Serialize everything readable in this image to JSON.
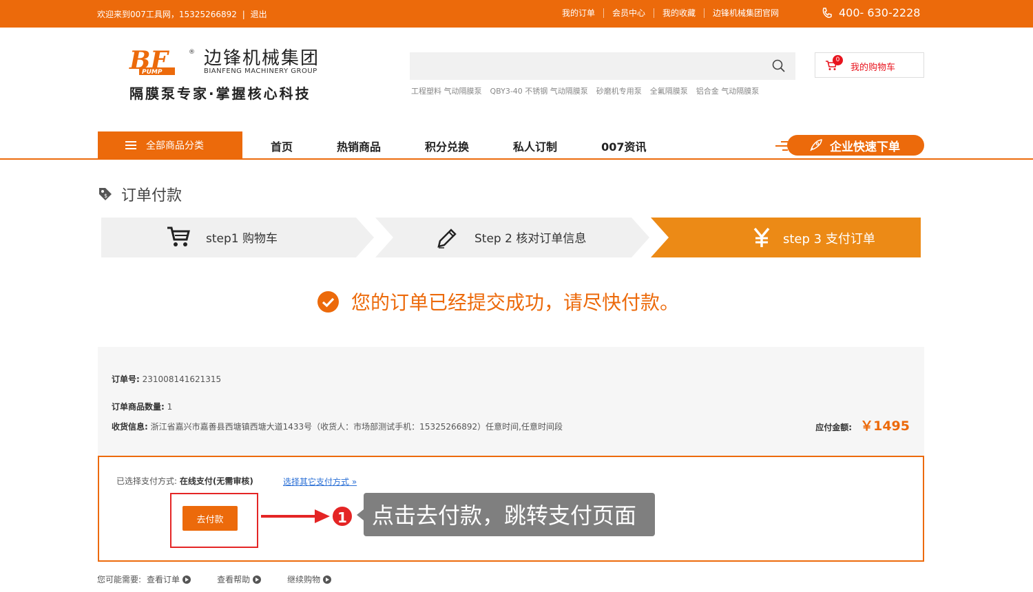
{
  "topbar": {
    "welcome": "欢迎来到007工具网，15325266892",
    "separator": "|",
    "logout": "退出",
    "links": [
      "我的订单",
      "会员中心",
      "我的收藏",
      "边锋机械集团官网"
    ],
    "phone": "400- 630-2228"
  },
  "logo": {
    "mark_text": "BF",
    "mark_sub": "PUMP",
    "cn": "边锋机械集团",
    "en": "BIANFENG MACHINERY GROUP",
    "slogan": "隔膜泵专家·掌握核心科技"
  },
  "search": {
    "hotwords": [
      "工程塑料 气动隔膜泵",
      "QBY3-40 不锈钢 气动隔膜泵",
      "砂磨机专用泵",
      "全氟隔膜泵",
      "铝合金 气动隔膜泵"
    ]
  },
  "cart": {
    "count": "0",
    "label": "我的购物车"
  },
  "nav": {
    "category": "全部商品分类",
    "items": [
      "首页",
      "热销商品",
      "积分兑换",
      "私人订制",
      "007资讯"
    ],
    "quick_order": "企业快速下单"
  },
  "page_title": "订单付款",
  "steps": [
    {
      "label": "step1  购物车"
    },
    {
      "label": "Step 2 核对订单信息"
    },
    {
      "label": "step 3 支付订单"
    }
  ],
  "success_message": "您的订单已经提交成功，请尽快付款。",
  "order": {
    "number_label": "订单号:",
    "number": "231008141621315",
    "qty_label": "订单商品数量:",
    "qty": "1",
    "address_label": "收货信息:",
    "address": "浙江省嘉兴市嘉善县西塘镇西塘大道1433号（收货人：市场部测试手机：15325266892）任意时间,任意时间段",
    "due_label": "应付金额:",
    "due_amount": "￥1495"
  },
  "payment": {
    "method_label": "已选择支付方式:",
    "method": "在线支付(无需审核)",
    "other_link": "选择其它支付方式 »",
    "go_pay": "去付款"
  },
  "annotation": {
    "number": "1",
    "text": "点击去付款，跳转支付页面"
  },
  "more": {
    "label": "您可能需要:",
    "links": [
      "查看订单",
      "查看帮助",
      "继续购物"
    ]
  },
  "colors": {
    "brand": "#ec6a0b",
    "highlight": "#e42525",
    "callout": "#7f7f7f"
  }
}
